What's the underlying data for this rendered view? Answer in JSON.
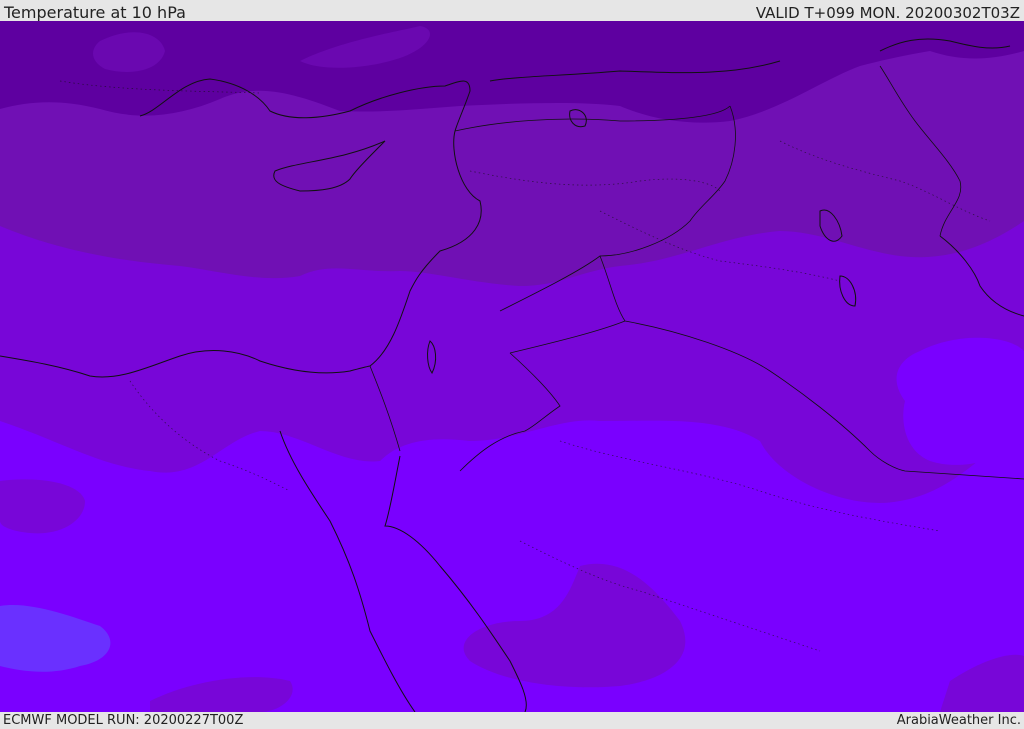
{
  "header": {
    "title": "Temperature at 10 hPa",
    "valid_time": "VALID T+099 MON. 20200302T03Z"
  },
  "footer": {
    "model_run": "ECMWF MODEL RUN: 20200227T00Z",
    "credit": "ArabiaWeather Inc."
  },
  "map": {
    "colors": {
      "band_coldest": "#5e00a0",
      "band_cold": "#7010b4",
      "band_mid": "#7806d8",
      "band_warm": "#7800f0",
      "band_base": "#7a00ff",
      "band_warmest": "#6a30ff",
      "coastline": "#111111"
    }
  }
}
